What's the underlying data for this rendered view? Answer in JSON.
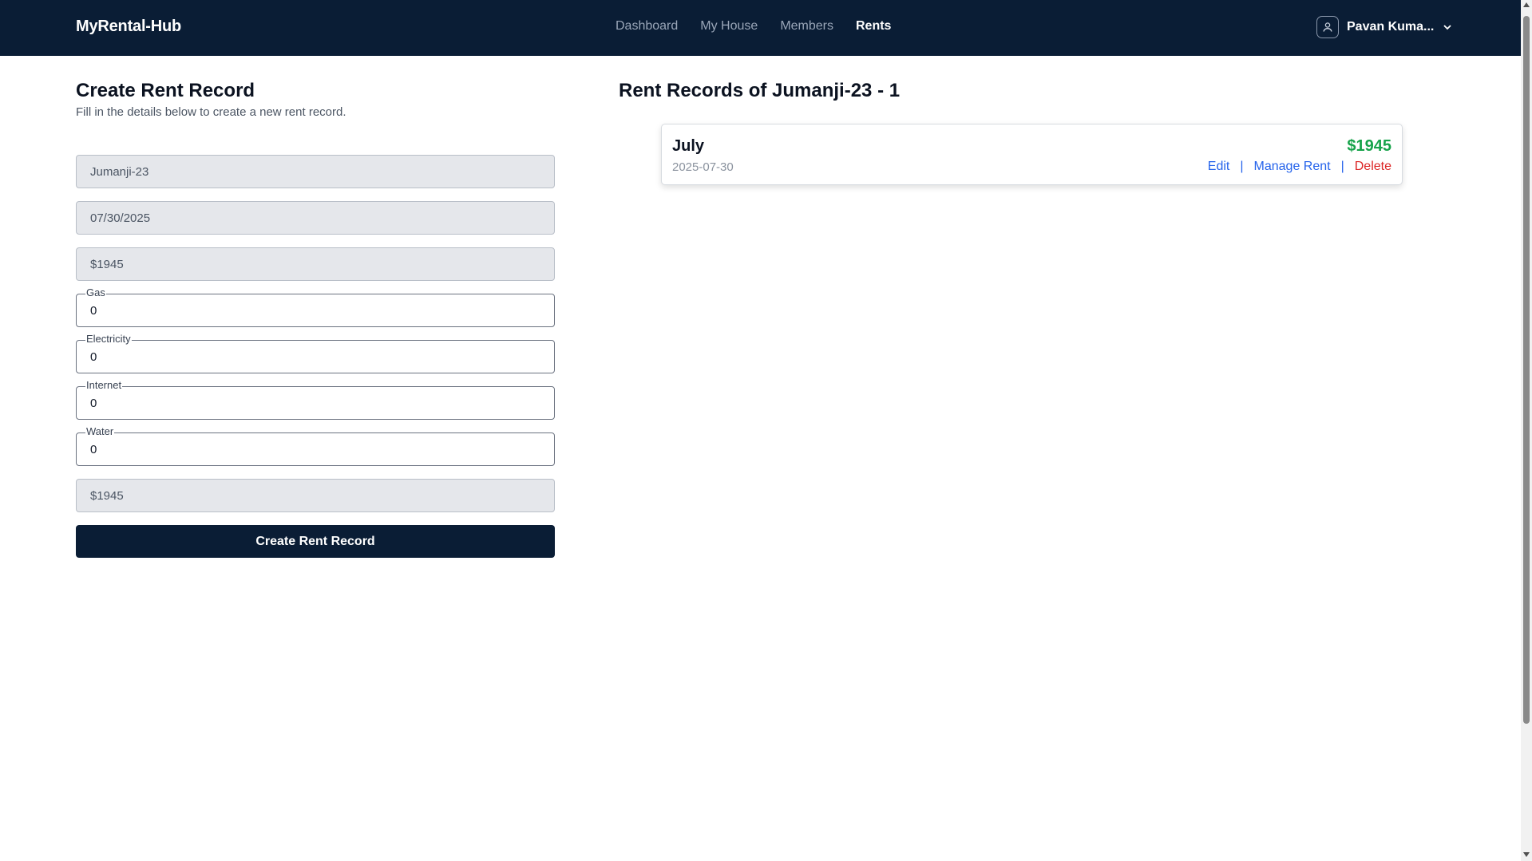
{
  "header": {
    "brand": "MyRental-Hub",
    "nav": [
      "Dashboard",
      "My House",
      "Members",
      "Rents"
    ],
    "active_nav": "Rents",
    "user_name": "Pavan Kuma..."
  },
  "form": {
    "title": "Create Rent Record",
    "subtitle": "Fill in the details below to create a new rent record.",
    "house_value": "Jumanji-23",
    "date_value": "07/30/2025",
    "rent_value": "$1945",
    "gas_label": "Gas",
    "gas_value": "0",
    "electricity_label": "Electricity",
    "electricity_value": "0",
    "internet_label": "Internet",
    "internet_value": "0",
    "water_label": "Water",
    "water_value": "0",
    "total_value": "$1945",
    "submit_label": "Create Rent Record"
  },
  "records": {
    "title": "Rent Records of Jumanji-23 - 1",
    "items": [
      {
        "month": "July",
        "date": "2025-07-30",
        "amount": "$1945",
        "edit_label": "Edit",
        "manage_label": "Manage Rent",
        "delete_label": "Delete",
        "separator": "|"
      }
    ]
  },
  "colors": {
    "nav_bg": "#0a1d35",
    "amount": "#16a34a",
    "link": "#2563eb",
    "delete": "#dc2626"
  }
}
